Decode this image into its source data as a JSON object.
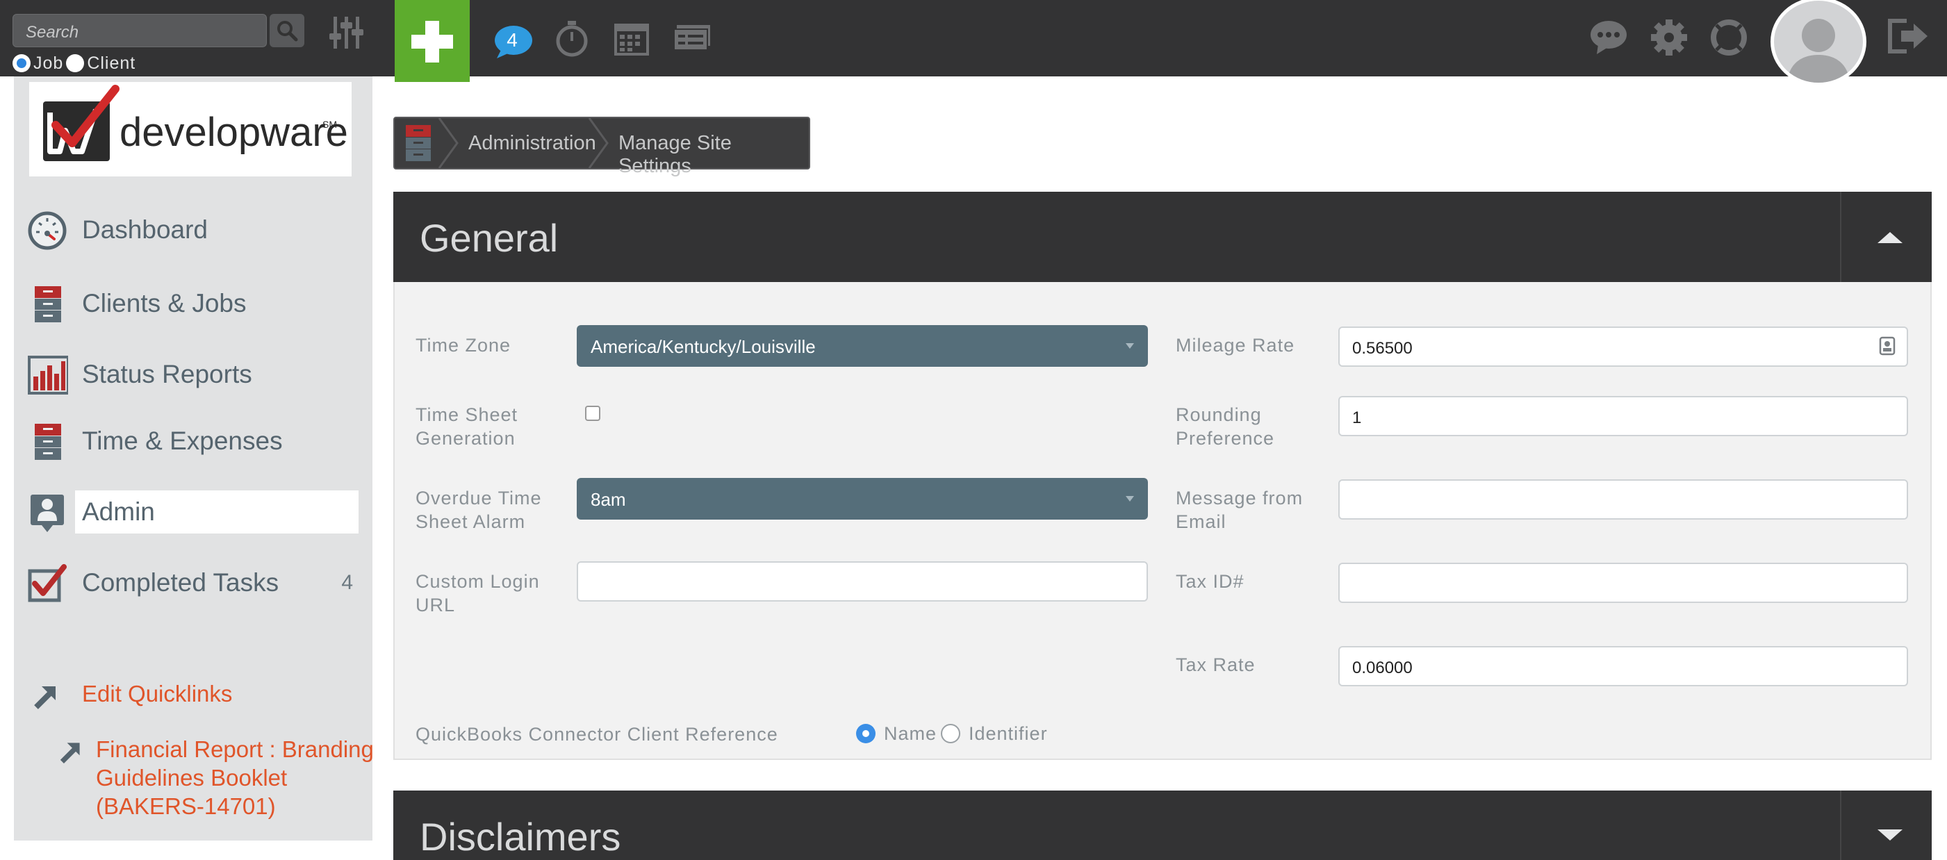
{
  "topbar": {
    "search_placeholder": "Search",
    "search_scope": [
      {
        "label": "Job",
        "selected": true
      },
      {
        "label": "Client",
        "selected": false
      }
    ],
    "notification_count": "4",
    "icons": [
      "search-icon",
      "filter-sliders-icon",
      "add-plus-icon",
      "chat-bubble-icon",
      "stopwatch-icon",
      "calendar-icon",
      "tickets-icon",
      "messages-icon",
      "gear-icon",
      "help-lifebuoy-icon",
      "user-avatar-icon",
      "logout-icon"
    ]
  },
  "sidebar": {
    "logo_text": "developware",
    "logo_mark": "SM",
    "items": [
      {
        "label": "Dashboard",
        "icon": "speedometer-icon"
      },
      {
        "label": "Clients & Jobs",
        "icon": "file-cabinet-icon"
      },
      {
        "label": "Status Reports",
        "icon": "bar-chart-icon"
      },
      {
        "label": "Time & Expenses",
        "icon": "file-cabinet-icon"
      },
      {
        "label": "Admin",
        "icon": "admin-user-icon",
        "active": true
      },
      {
        "label": "Completed Tasks",
        "icon": "checkmark-box-icon",
        "count": "4"
      }
    ],
    "quicklinks": {
      "edit_label": "Edit Quicklinks",
      "links": [
        {
          "line1": "Financial Report : Branding",
          "line2": "Guidelines Booklet",
          "line3": "(BAKERS-14701)"
        }
      ]
    }
  },
  "breadcrumb": {
    "items": [
      "Administration",
      "Manage Site Settings"
    ]
  },
  "general": {
    "title": "General",
    "fields": {
      "time_zone": {
        "label": "Time Zone",
        "value": "America/Kentucky/Louisville"
      },
      "time_sheet_generation": {
        "label1": "Time Sheet",
        "label2": "Generation",
        "checked": false
      },
      "overdue_alarm": {
        "label1": "Overdue Time",
        "label2": "Sheet Alarm",
        "value": "8am"
      },
      "custom_login_url": {
        "label1": "Custom Login",
        "label2": "URL",
        "value": ""
      },
      "mileage_rate": {
        "label": "Mileage Rate",
        "value": "0.56500"
      },
      "rounding_preference": {
        "label1": "Rounding",
        "label2": "Preference",
        "value": "1"
      },
      "message_from_email": {
        "label1": "Message from",
        "label2": "Email",
        "value": ""
      },
      "tax_id": {
        "label": "Tax ID#",
        "value": ""
      },
      "tax_rate": {
        "label": "Tax Rate",
        "value": "0.06000"
      },
      "qb_reference": {
        "label": "QuickBooks Connector Client Reference",
        "options": [
          {
            "label": "Name",
            "selected": true
          },
          {
            "label": "Identifier",
            "selected": false
          }
        ]
      }
    }
  },
  "disclaimers": {
    "title": "Disclaimers"
  },
  "colors": {
    "topbar": "#333334",
    "add_button": "#5dac2d",
    "select_fill": "#556e7a",
    "link_accent": "#e0552a",
    "radio_selected": "#3a8ee6"
  }
}
